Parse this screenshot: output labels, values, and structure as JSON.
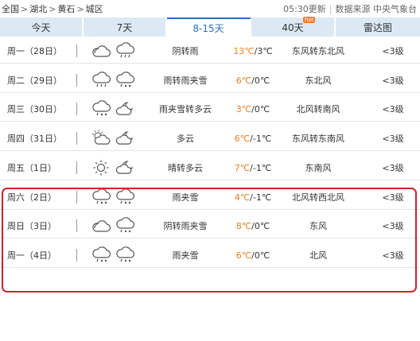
{
  "breadcrumb": {
    "items": [
      "全国",
      "湖北",
      "黄石",
      "城区"
    ],
    "separator": ">"
  },
  "top_right": {
    "update_time": "05:30更新",
    "source": "数据来源 中央气象台"
  },
  "tabs": [
    {
      "label": "今天",
      "active": false
    },
    {
      "label": "7天",
      "active": false
    },
    {
      "label": "8-15天",
      "active": true
    },
    {
      "label": "40天",
      "active": false,
      "badge": "hot"
    },
    {
      "label": "雷达图",
      "active": false
    }
  ],
  "colors": {
    "tab_bg": "#dce9f5",
    "tab_active_text": "#2a6ebb",
    "high_temp": "#ef7d1a",
    "highlight_border": "#d6202a",
    "badge": "#f27a2a"
  },
  "forecast": [
    {
      "day": "周一（28日）",
      "icons": [
        "cloudy-icon",
        "rain-icon"
      ],
      "desc": "阴转雨",
      "high": "13℃",
      "low": "3℃",
      "wind": "东风转东北风",
      "level": "<3级"
    },
    {
      "day": "周二（29日）",
      "icons": [
        "rain-icon",
        "sleet-icon"
      ],
      "desc": "雨转雨夹雪",
      "high": "6℃",
      "low": "0℃",
      "wind": "东北风",
      "level": "<3级"
    },
    {
      "day": "周三（30日）",
      "icons": [
        "sleet-icon",
        "partly-cloudy-night-icon"
      ],
      "desc": "雨夹雪转多云",
      "high": "3℃",
      "low": "0℃",
      "wind": "北风转南风",
      "level": "<3级"
    },
    {
      "day": "周四（31日）",
      "icons": [
        "partly-cloudy-icon",
        "partly-cloudy-night-icon"
      ],
      "desc": "多云",
      "high": "6℃",
      "low": "-1℃",
      "wind": "东风转东南风",
      "level": "<3级"
    },
    {
      "day": "周五（1日）",
      "icons": [
        "sun-icon",
        "partly-cloudy-night-icon"
      ],
      "desc": "晴转多云",
      "high": "7℃",
      "low": "-1℃",
      "wind": "东南风",
      "level": "<3级"
    },
    {
      "day": "周六（2日）",
      "icons": [
        "sleet-icon",
        "sleet-icon"
      ],
      "desc": "雨夹雪",
      "high": "4℃",
      "low": "-1℃",
      "wind": "北风转西北风",
      "level": "<3级"
    },
    {
      "day": "周日（3日）",
      "icons": [
        "cloudy-icon",
        "sleet-icon"
      ],
      "desc": "阴转雨夹雪",
      "high": "8℃",
      "low": "0℃",
      "wind": "东风",
      "level": "<3级"
    },
    {
      "day": "周一（4日）",
      "icons": [
        "sleet-icon",
        "sleet-icon"
      ],
      "desc": "雨夹雪",
      "high": "6℃",
      "low": "0℃",
      "wind": "北风",
      "level": "<3级"
    }
  ]
}
